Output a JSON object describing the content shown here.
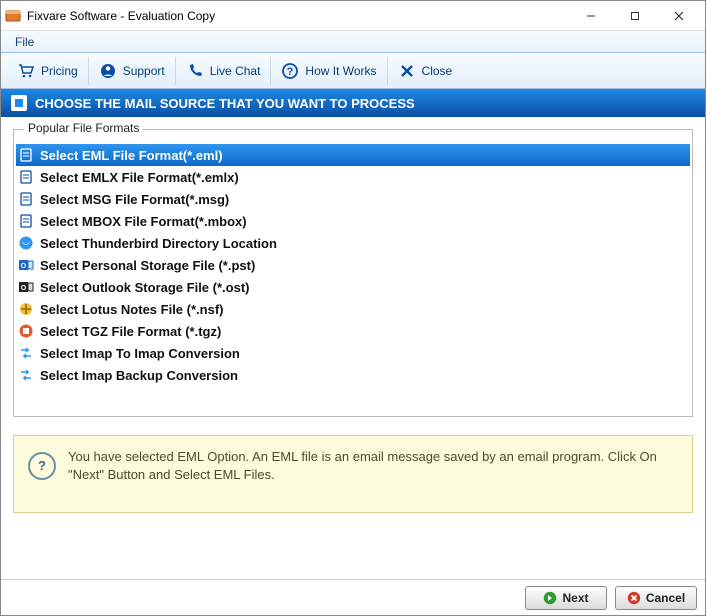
{
  "window": {
    "title": "Fixvare Software - Evaluation Copy"
  },
  "menubar": {
    "file": "File"
  },
  "toolbar": {
    "pricing": "Pricing",
    "support": "Support",
    "livechat": "Live Chat",
    "howitworks": "How It Works",
    "close": "Close"
  },
  "section_header": "CHOOSE THE MAIL SOURCE THAT YOU WANT TO PROCESS",
  "group": {
    "legend": "Popular File Formats"
  },
  "formats": [
    {
      "label": "Select EML File Format(*.eml)",
      "icon": "file-eml",
      "selected": true
    },
    {
      "label": "Select EMLX File Format(*.emlx)",
      "icon": "file-emlx",
      "selected": false
    },
    {
      "label": "Select MSG File Format(*.msg)",
      "icon": "file-msg",
      "selected": false
    },
    {
      "label": "Select MBOX File Format(*.mbox)",
      "icon": "file-mbox",
      "selected": false
    },
    {
      "label": "Select Thunderbird Directory Location",
      "icon": "thunderbird",
      "selected": false
    },
    {
      "label": "Select Personal Storage File (*.pst)",
      "icon": "outlook-pst",
      "selected": false
    },
    {
      "label": "Select Outlook Storage File (*.ost)",
      "icon": "outlook-ost",
      "selected": false
    },
    {
      "label": "Select Lotus Notes File (*.nsf)",
      "icon": "lotus",
      "selected": false
    },
    {
      "label": "Select TGZ File Format (*.tgz)",
      "icon": "tgz",
      "selected": false
    },
    {
      "label": "Select Imap To Imap Conversion",
      "icon": "imap",
      "selected": false
    },
    {
      "label": "Select Imap Backup Conversion",
      "icon": "imap-backup",
      "selected": false
    }
  ],
  "info": {
    "text": "You have selected EML Option. An EML file is an email message saved by an email program. Click On \"Next\" Button and Select EML Files."
  },
  "footer": {
    "next": "Next",
    "cancel": "Cancel"
  },
  "colors": {
    "accent": "#0d69ca",
    "header_grad_top": "#1e88e5",
    "header_grad_bot": "#0a4fa1",
    "info_bg": "#fcfbdb"
  }
}
